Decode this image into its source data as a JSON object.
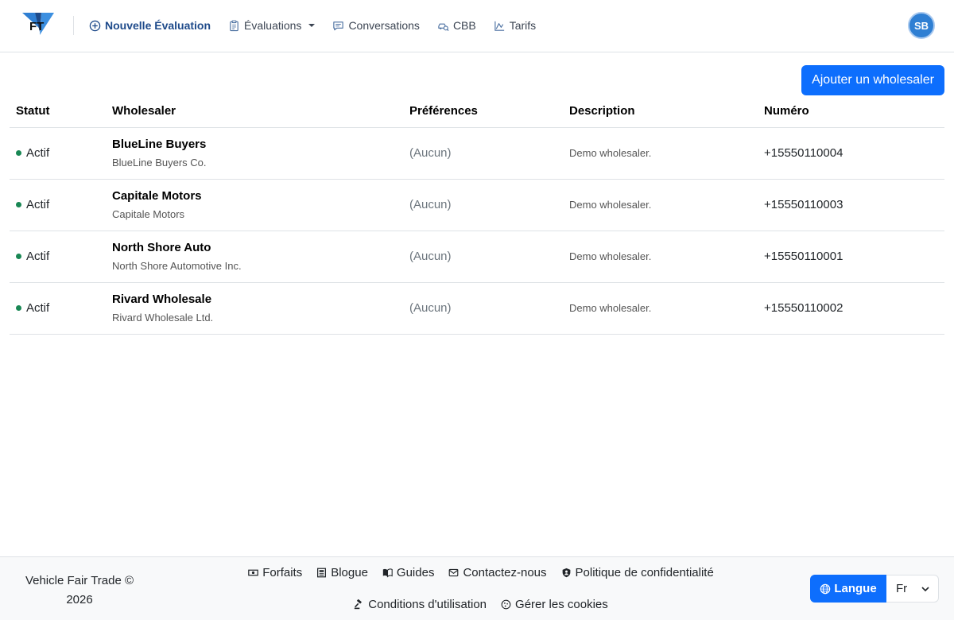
{
  "brand": {
    "logo_text": "FT",
    "colors": {
      "accent": "#0d6efd",
      "nav_primary": "#1e4a8a",
      "status_active": "#198754",
      "avatar": "#2f7fd3"
    }
  },
  "nav": {
    "items": [
      {
        "label": "Nouvelle Évaluation",
        "icon": "plus-circle-icon"
      },
      {
        "label": "Évaluations",
        "icon": "clipboard-icon"
      },
      {
        "label": "Conversations",
        "icon": "chat-icon"
      },
      {
        "label": "CBB",
        "icon": "car-search-icon"
      },
      {
        "label": "Tarifs",
        "icon": "chart-icon"
      }
    ]
  },
  "user": {
    "initials": "SB"
  },
  "actions": {
    "add_label": "Ajouter un wholesaler"
  },
  "table": {
    "headers": [
      "Statut",
      "Wholesaler",
      "Préférences",
      "Description",
      "Numéro"
    ],
    "rows": [
      {
        "status": "Actif",
        "name": "BlueLine Buyers",
        "legal": "BlueLine Buyers Co.",
        "prefs": "(Aucun)",
        "description": "Demo wholesaler.",
        "phone": "+15550110004"
      },
      {
        "status": "Actif",
        "name": "Capitale Motors",
        "legal": "Capitale Motors",
        "prefs": "(Aucun)",
        "description": "Demo wholesaler.",
        "phone": "+15550110003"
      },
      {
        "status": "Actif",
        "name": "North Shore Auto",
        "legal": "North Shore Automotive Inc.",
        "prefs": "(Aucun)",
        "description": "Demo wholesaler.",
        "phone": "+15550110001"
      },
      {
        "status": "Actif",
        "name": "Rivard Wholesale",
        "legal": "Rivard Wholesale Ltd.",
        "prefs": "(Aucun)",
        "description": "Demo wholesaler.",
        "phone": "+15550110002"
      }
    ]
  },
  "footer": {
    "copyright_line1": "Vehicle Fair Trade ©",
    "copyright_line2": "2026",
    "links": [
      {
        "label": "Forfaits",
        "icon": "cash-icon"
      },
      {
        "label": "Blogue",
        "icon": "newspaper-icon"
      },
      {
        "label": "Guides",
        "icon": "book-icon"
      },
      {
        "label": "Contactez-nous",
        "icon": "envelope-icon"
      },
      {
        "label": "Politique de confidentialité",
        "icon": "shield-person-icon"
      },
      {
        "label": "Conditions d'utilisation",
        "icon": "gavel-icon"
      },
      {
        "label": "Gérer les cookies",
        "icon": "cookie-icon"
      }
    ],
    "language_label": "Langue",
    "language_value": "Fr"
  }
}
